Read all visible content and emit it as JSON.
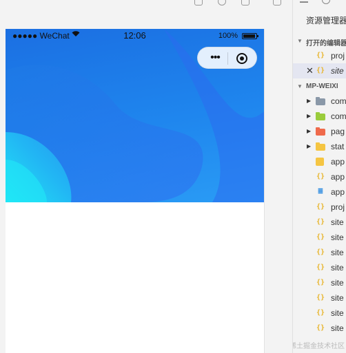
{
  "simulator": {
    "status_bar": {
      "signal": "●●●●● WeChat",
      "time": "12:06",
      "battery_percent": "100%"
    },
    "capsule": {
      "more_label": "•••"
    },
    "hero_colors": {
      "top": "#1b6fe2",
      "bottom": "#2a9cf5",
      "glow": "#1fe6f5"
    }
  },
  "explorer": {
    "title": "资源管理器",
    "open_editors": {
      "label": "打开的编辑器",
      "files": [
        {
          "name": "proj",
          "icon": "json-icon",
          "selected": false
        },
        {
          "name": "site",
          "icon": "json-icon",
          "selected": true
        }
      ]
    },
    "project": {
      "label": "MP-WEIXI",
      "items": [
        {
          "name": "com",
          "icon": "folder-icon",
          "color": "#8a98a8",
          "is_folder": true
        },
        {
          "name": "com",
          "icon": "folder-icon",
          "color": "#9acc3c",
          "is_folder": true
        },
        {
          "name": "pag",
          "icon": "folder-icon",
          "color": "#ef6a4b",
          "is_folder": true
        },
        {
          "name": "stat",
          "icon": "folder-icon",
          "color": "#f5c542",
          "is_folder": true
        },
        {
          "name": "app",
          "icon": "js-icon",
          "color": "#f5c542",
          "is_folder": false
        },
        {
          "name": "app",
          "icon": "json-icon",
          "color": "#e8b52d",
          "is_folder": false
        },
        {
          "name": "app",
          "icon": "css-icon",
          "color": "#2d8be0",
          "is_folder": false
        },
        {
          "name": "proj",
          "icon": "json-icon",
          "color": "#e8b52d",
          "is_folder": false
        },
        {
          "name": "site",
          "icon": "json-icon",
          "color": "#e8b52d",
          "is_folder": false
        },
        {
          "name": "site",
          "icon": "json-icon",
          "color": "#e8b52d",
          "is_folder": false
        },
        {
          "name": "site",
          "icon": "json-icon",
          "color": "#e8b52d",
          "is_folder": false
        },
        {
          "name": "site",
          "icon": "json-icon",
          "color": "#e8b52d",
          "is_folder": false
        },
        {
          "name": "site",
          "icon": "json-icon",
          "color": "#e8b52d",
          "is_folder": false
        },
        {
          "name": "site",
          "icon": "json-icon",
          "color": "#e8b52d",
          "is_folder": false
        },
        {
          "name": "site",
          "icon": "json-icon",
          "color": "#e8b52d",
          "is_folder": false
        },
        {
          "name": "site",
          "icon": "json-icon",
          "color": "#e8b52d",
          "is_folder": false
        }
      ]
    }
  },
  "watermark": "@稀土掘金技术社区"
}
